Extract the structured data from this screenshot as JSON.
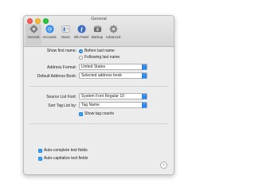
{
  "window": {
    "title": "General"
  },
  "toolbar": {
    "items": [
      {
        "label": "General",
        "icon": "gear-icon",
        "selected": true
      },
      {
        "label": "Accounts",
        "icon": "at-icon",
        "selected": false
      },
      {
        "label": "Views",
        "icon": "card-icon",
        "selected": false
      },
      {
        "label": "Info Panel",
        "icon": "info-icon",
        "selected": false
      },
      {
        "label": "Backup",
        "icon": "backup-icon",
        "selected": false
      },
      {
        "label": "Advanced",
        "icon": "gear-advanced-icon",
        "selected": false
      }
    ]
  },
  "general": {
    "show_first_name_label": "Show first name:",
    "before_last_name": "Before last name",
    "following_last_name": "Following last name",
    "address_format_label": "Address Format:",
    "address_format_value": "United States",
    "default_address_book_label": "Default Address Book:",
    "default_address_book_value": "Selected address book",
    "source_list_font_label": "Source List Font:",
    "source_list_font_value": "System Font Regular 10",
    "sort_tag_list_label": "Sort Tag List by:",
    "sort_tag_list_value": "Tag Name",
    "show_tag_counts": "Show tag counts",
    "autocomplete": "Auto-complete text fields",
    "autocapitalize": "Auto-capitalize text fields",
    "help": "?"
  },
  "colors": {
    "accent": "#1f8ef1"
  }
}
